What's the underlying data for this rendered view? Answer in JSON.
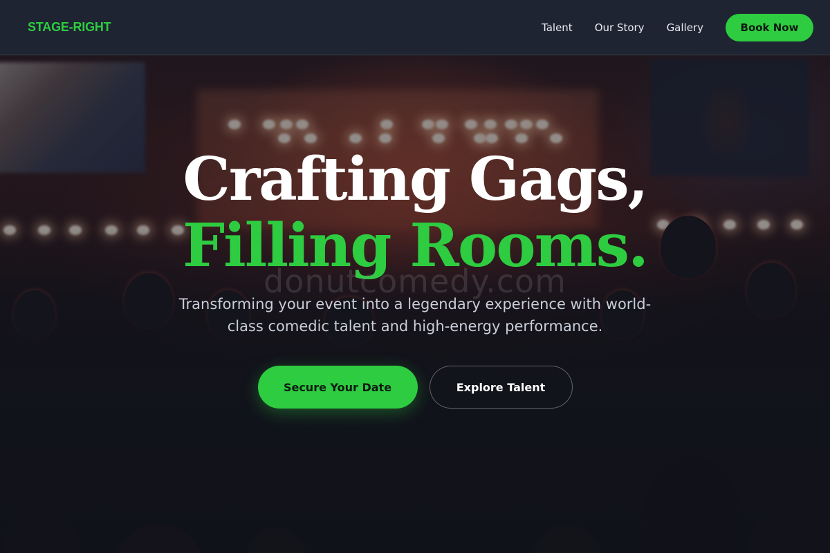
{
  "nav": {
    "logo": "STAGE-RIGHT",
    "links": [
      {
        "label": "Talent"
      },
      {
        "label": "Our Story"
      },
      {
        "label": "Gallery"
      }
    ],
    "cta_label": "Book Now"
  },
  "hero": {
    "headline_line1": "Crafting Gags,",
    "headline_line2": "Filling Rooms.",
    "watermark": "donutcomedy.com",
    "subtitle": "Transforming your event into a legendary experience with world-class comedic talent and high-energy performance.",
    "primary_button": "Secure Your Date",
    "secondary_button": "Explore Talent"
  },
  "colors": {
    "accent": "#2ecc40",
    "nav_bg": "#1e2634",
    "text_light": "#ffffff"
  }
}
